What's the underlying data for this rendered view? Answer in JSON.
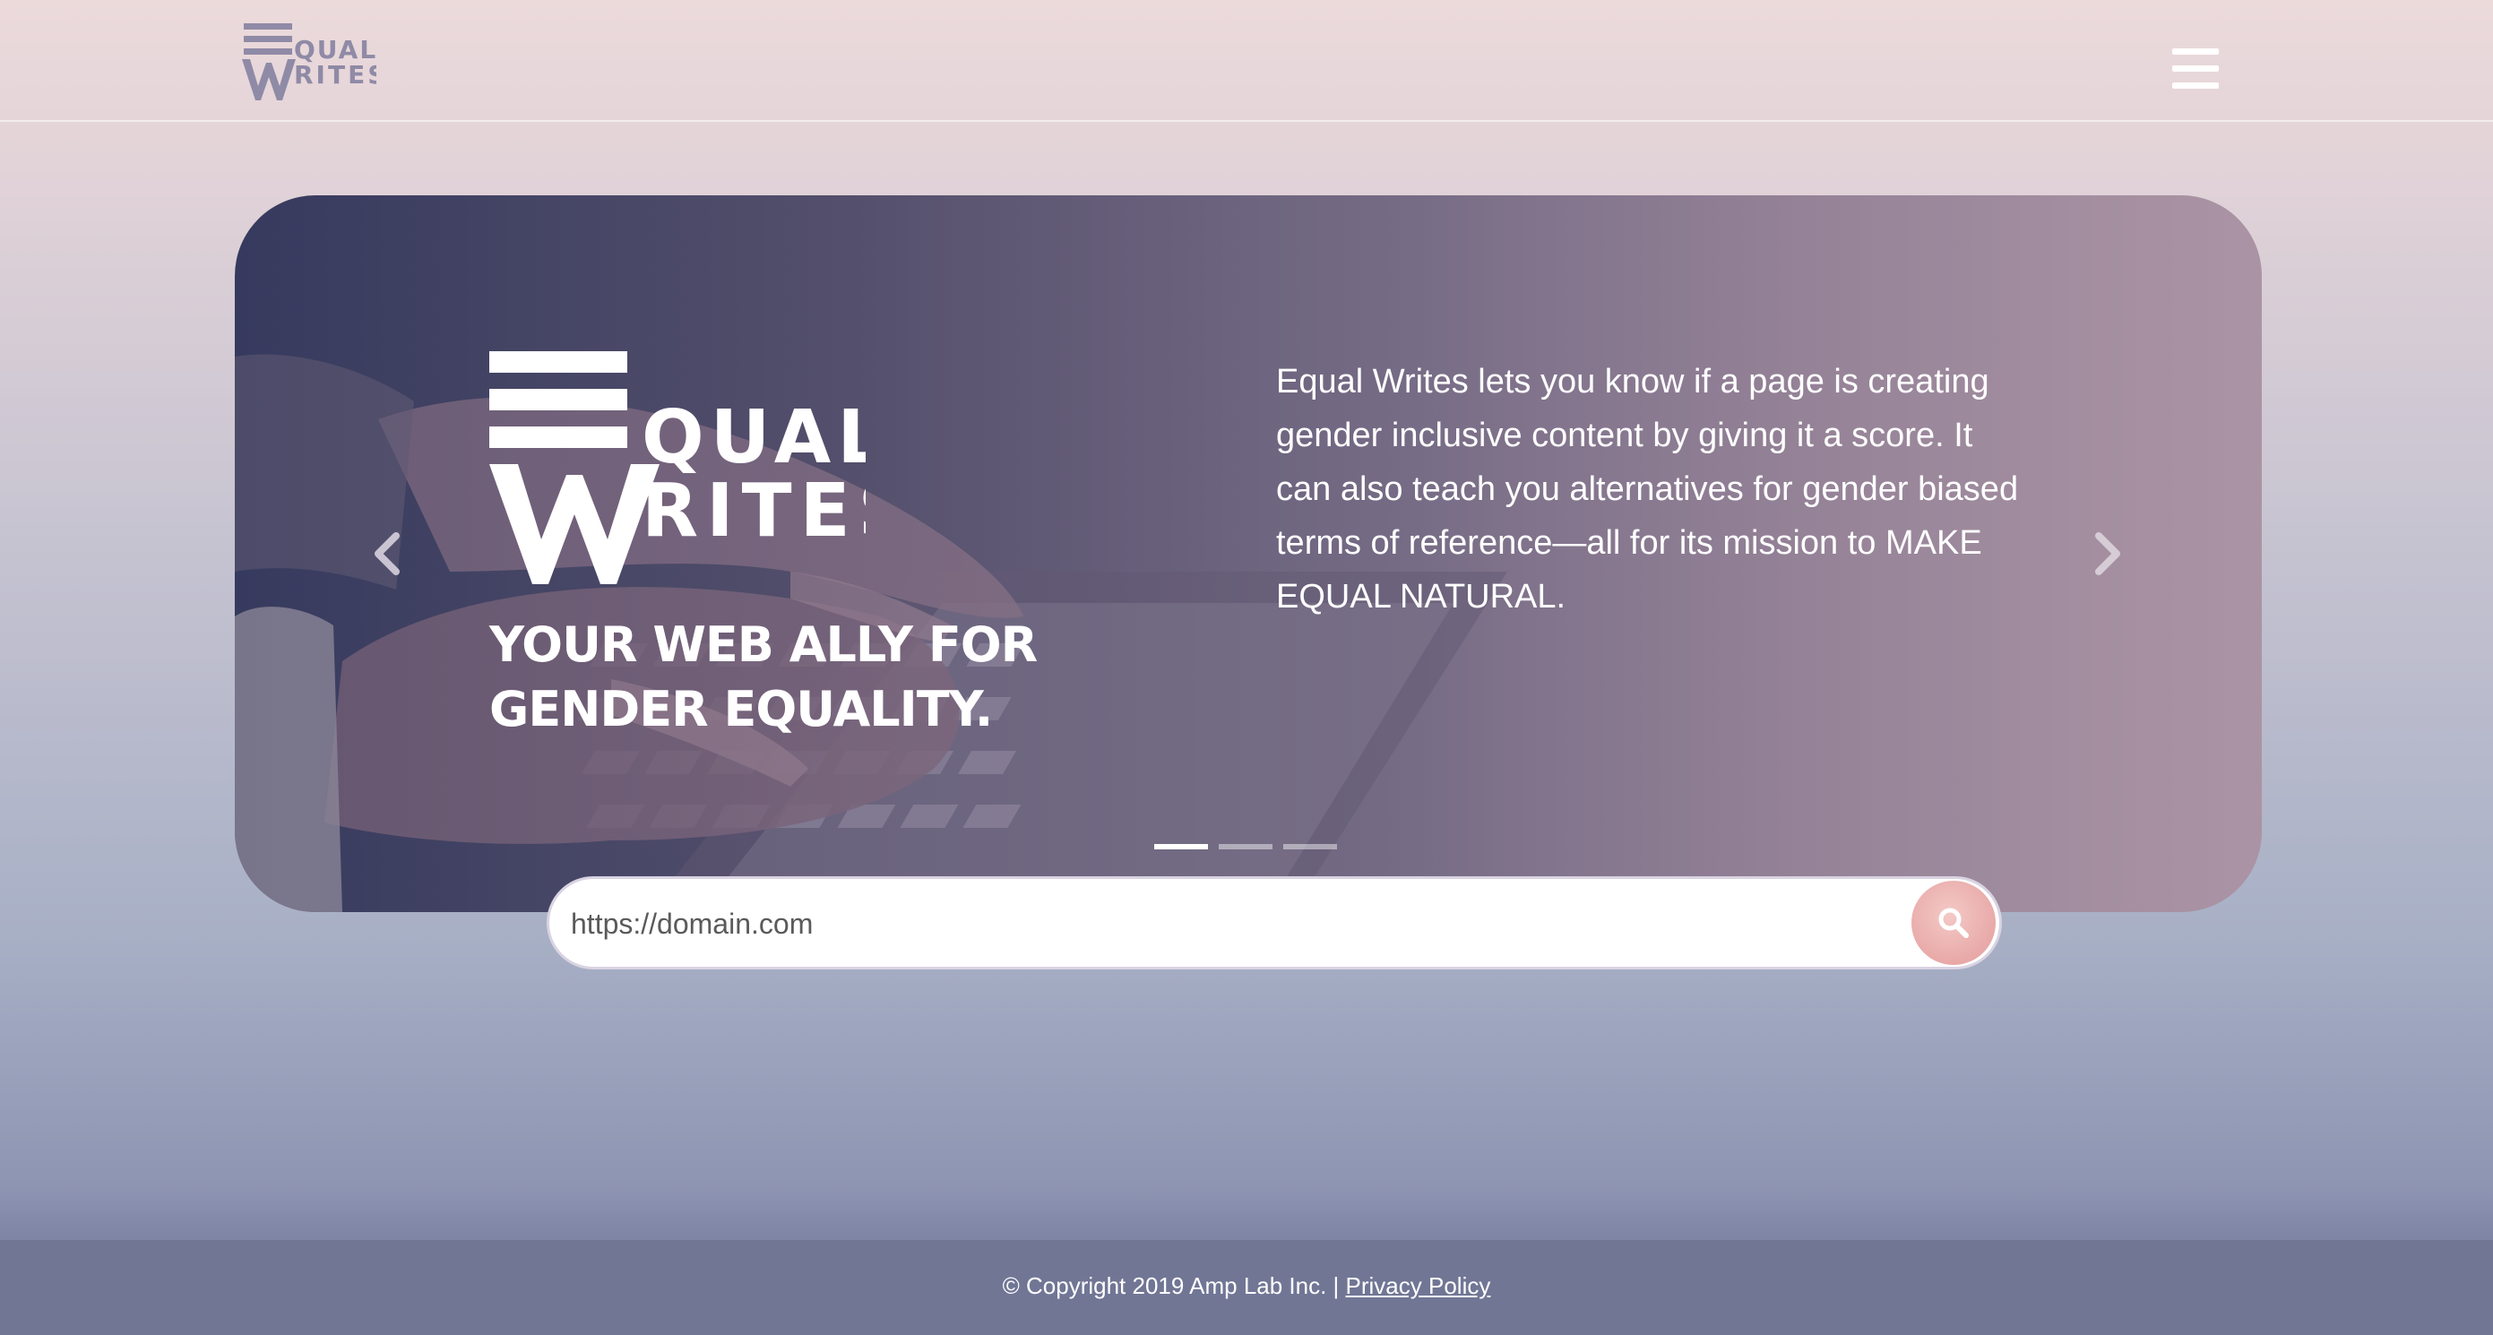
{
  "header": {
    "logo": {
      "line1": "QUAL",
      "line2": "RITES",
      "initial1": "E",
      "initial2": "W",
      "alt": "EQUAL WRITES"
    },
    "menu_icon": "hamburger-menu-icon"
  },
  "hero": {
    "logo": {
      "line1": "QUAL",
      "line2": "RITES"
    },
    "title": "YOUR WEB ALLY FOR GENDER EQUALITY.",
    "description": "Equal Writes lets you know if a page is creating gender inclusive content by giving it a score. It can also teach you alternatives for gender biased terms of reference—all for its mission to MAKE EQUAL NATURAL.",
    "prev_icon": "chevron-left-icon",
    "next_icon": "chevron-right-icon",
    "slide_count": 3,
    "active_slide": 1
  },
  "search": {
    "placeholder": "https://domain.com",
    "value": "",
    "button_icon": "search-icon"
  },
  "footer": {
    "copyright": "© Copyright 2019 Amp Lab Inc. | ",
    "privacy_link": "Privacy Policy"
  },
  "colors": {
    "accent_pink": "#e8a9a8",
    "footer_bg": "#717695",
    "hero_dark": "#363a5e",
    "white": "#ffffff"
  }
}
